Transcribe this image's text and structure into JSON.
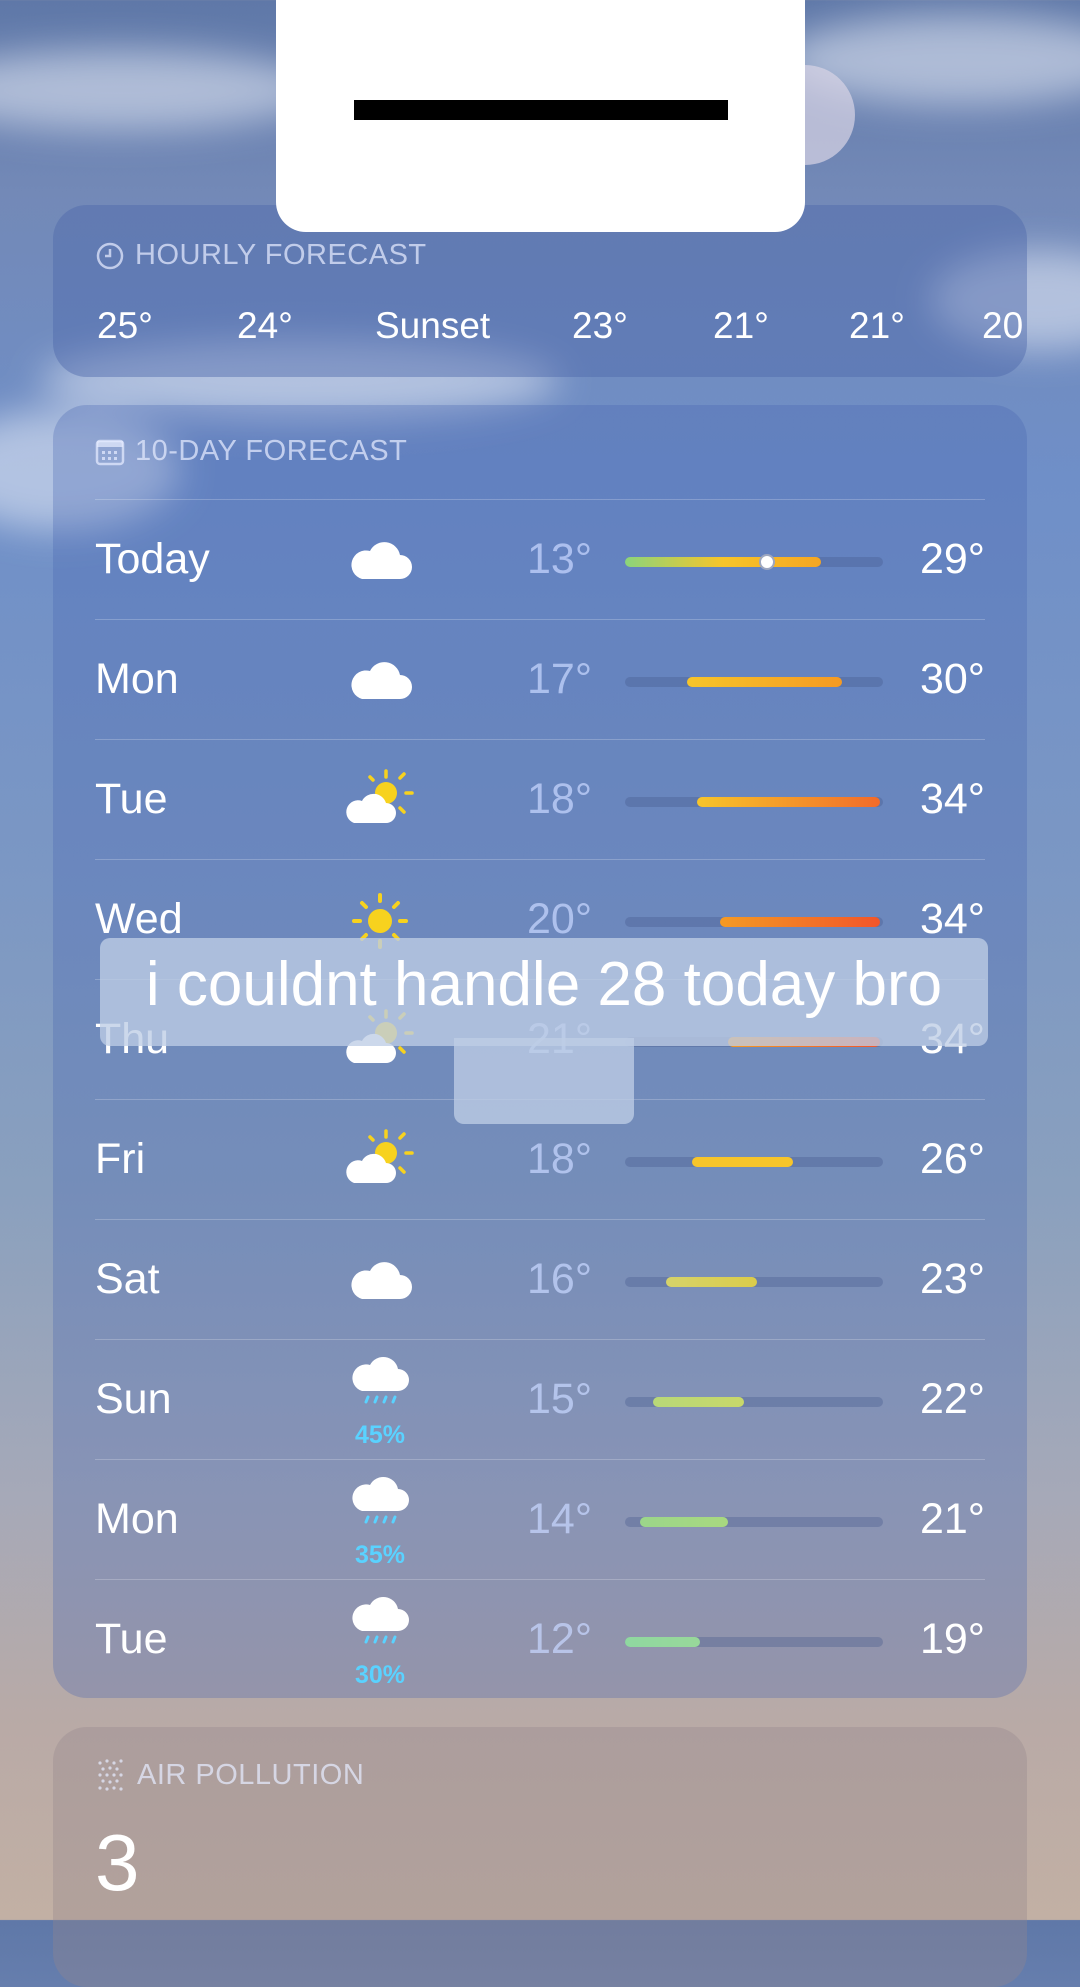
{
  "hourly": {
    "title": "HOURLY FORECAST",
    "items": [
      "25°",
      "24°",
      "Sunset",
      "23°",
      "21°",
      "21°",
      "20"
    ]
  },
  "ten_day": {
    "title": "10-DAY FORECAST",
    "days": [
      {
        "day": "Today",
        "icon": "cloud-icon",
        "low": "13°",
        "high": "29°",
        "pct": "",
        "bar": [
          0,
          0.76
        ],
        "current": 0.55,
        "colors": [
          "#8bd47b",
          "#f7c52a",
          "#f5a623"
        ]
      },
      {
        "day": "Mon",
        "icon": "cloud-icon",
        "low": "17°",
        "high": "30°",
        "pct": "",
        "bar": [
          0.24,
          0.84
        ],
        "current": null,
        "colors": [
          "#f7c52a",
          "#f59a23"
        ]
      },
      {
        "day": "Tue",
        "icon": "partly-sunny-icon",
        "low": "18°",
        "high": "34°",
        "pct": "",
        "bar": [
          0.28,
          0.99
        ],
        "current": null,
        "colors": [
          "#f7c52a",
          "#f26b2a"
        ]
      },
      {
        "day": "Wed",
        "icon": "sun-icon",
        "low": "20°",
        "high": "34°",
        "pct": "",
        "bar": [
          0.37,
          0.99
        ],
        "current": null,
        "colors": [
          "#f59a23",
          "#f2552a"
        ]
      },
      {
        "day": "Thu",
        "icon": "partly-sunny-icon",
        "low": "21°",
        "high": "34°",
        "pct": "",
        "bar": [
          0.4,
          0.99
        ],
        "current": null,
        "colors": [
          "#f59a23",
          "#f2552a"
        ]
      },
      {
        "day": "Fri",
        "icon": "partly-sunny-icon",
        "low": "18°",
        "high": "26°",
        "pct": "",
        "bar": [
          0.26,
          0.65
        ],
        "current": null,
        "colors": [
          "#f7c52a",
          "#f7c52a"
        ]
      },
      {
        "day": "Sat",
        "icon": "cloud-icon",
        "low": "16°",
        "high": "23°",
        "pct": "",
        "bar": [
          0.16,
          0.51
        ],
        "current": null,
        "colors": [
          "#d6d36a",
          "#dbcc4a"
        ]
      },
      {
        "day": "Sun",
        "icon": "cloud-rain-icon",
        "low": "15°",
        "high": "22°",
        "pct": "45%",
        "bar": [
          0.11,
          0.46
        ],
        "current": null,
        "colors": [
          "#b8d878",
          "#c8d86a"
        ]
      },
      {
        "day": "Mon",
        "icon": "cloud-rain-icon",
        "low": "14°",
        "high": "21°",
        "pct": "35%",
        "bar": [
          0.06,
          0.4
        ],
        "current": null,
        "colors": [
          "#9bd68a",
          "#a8d880"
        ]
      },
      {
        "day": "Tue",
        "icon": "cloud-rain-icon",
        "low": "12°",
        "high": "19°",
        "pct": "30%",
        "bar": [
          0,
          0.29
        ],
        "current": null,
        "colors": [
          "#8fd8a0",
          "#98d89a"
        ]
      }
    ]
  },
  "air": {
    "title": "AIR POLLUTION",
    "value": "3"
  },
  "caption": "i couldnt handle 28 today bro"
}
